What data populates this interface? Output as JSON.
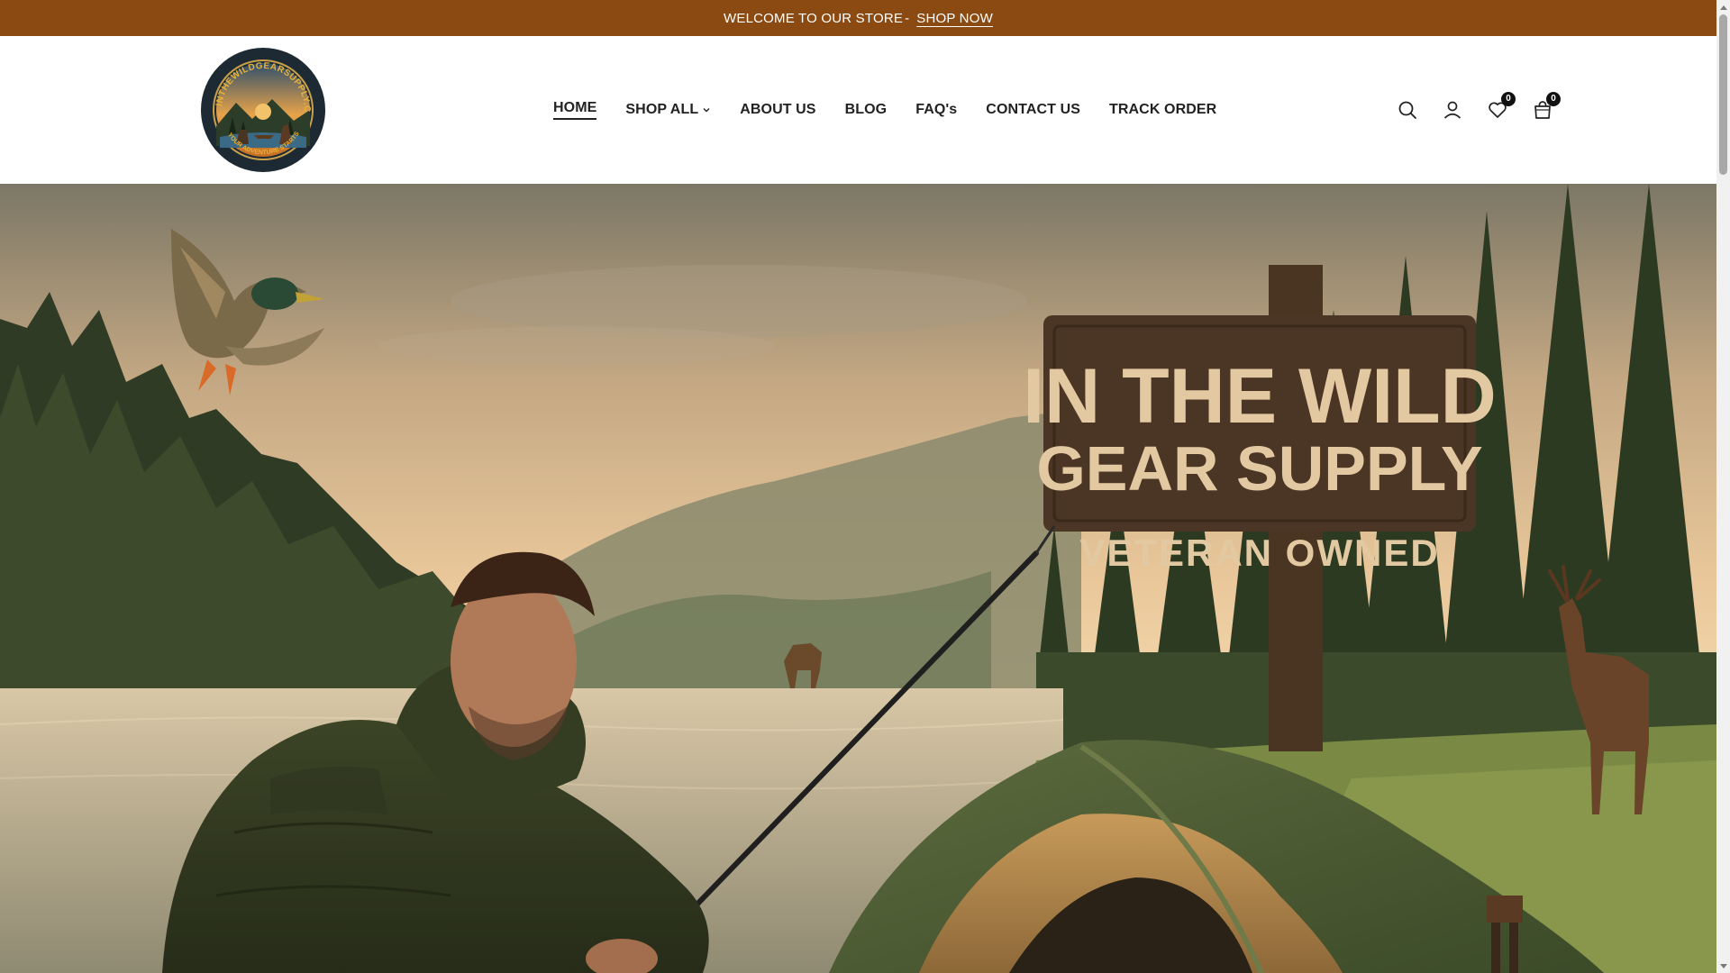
{
  "announcement": {
    "text": "WELCOME TO OUR STORE",
    "separator": "-",
    "link_label": "SHOP NOW"
  },
  "brand": {
    "logo_ring_text": "INTHEWILDGEARSUPPLY.COM",
    "logo_tagline": "YOUR ADVENTURE STARTS HERE"
  },
  "nav": {
    "items": [
      {
        "label": "HOME",
        "active": true
      },
      {
        "label": "SHOP ALL",
        "has_dropdown": true
      },
      {
        "label": "ABOUT US"
      },
      {
        "label": "BLOG"
      },
      {
        "label": "FAQ's"
      },
      {
        "label": "CONTACT US"
      },
      {
        "label": "TRACK ORDER"
      }
    ]
  },
  "header_icons": {
    "search": "search-icon",
    "account": "user-icon",
    "wishlist": "heart-icon",
    "wishlist_count": "0",
    "cart": "bag-icon",
    "cart_count": "0"
  },
  "hero": {
    "sign_line1": "IN THE WILD",
    "sign_line2": "GEAR SUPPLY",
    "sign_line3": "VETERAN OWNED"
  },
  "colors": {
    "announcement_bg": "#8b4a12",
    "nav_text": "#222222",
    "badge_bg": "#111111"
  }
}
